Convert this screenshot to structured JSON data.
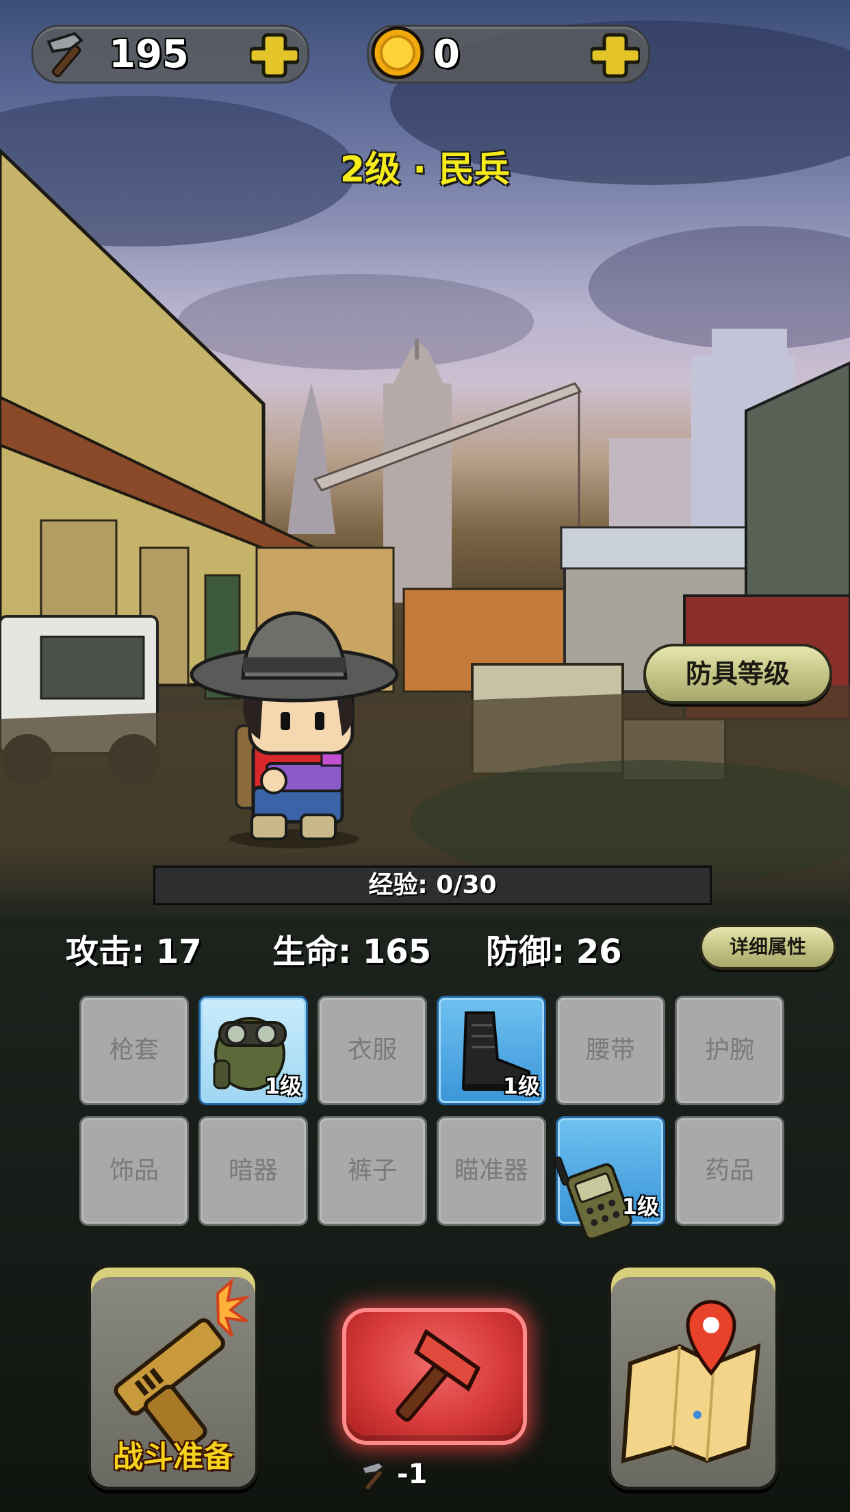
{
  "resources": {
    "hammers": {
      "icon": "hammer-icon",
      "value": "195"
    },
    "coins": {
      "icon": "gold-coin-icon",
      "value": "0"
    }
  },
  "rank_title": "2级 · 民兵",
  "armor_level_button": "防具等级",
  "experience": {
    "label": "经验: 0/30",
    "current": 0,
    "max": 30
  },
  "stats": {
    "attack": "攻击: 17",
    "health": "生命: 165",
    "defense": "防御: 26"
  },
  "details_button": "详细属性",
  "equipment_slots": [
    {
      "label": "枪套",
      "owned": false
    },
    {
      "label": "",
      "owned": true,
      "icon": "aviator-helmet-icon",
      "level": "1级"
    },
    {
      "label": "衣服",
      "owned": false
    },
    {
      "label": "",
      "owned": true,
      "icon": "combat-boot-icon",
      "level": "1级"
    },
    {
      "label": "腰带",
      "owned": false
    },
    {
      "label": "护腕",
      "owned": false
    },
    {
      "label": "饰品",
      "owned": false
    },
    {
      "label": "暗器",
      "owned": false
    },
    {
      "label": "裤子",
      "owned": false
    },
    {
      "label": "瞄准器",
      "owned": false
    },
    {
      "label": "",
      "owned": true,
      "icon": "walkie-talkie-icon",
      "level": "1级"
    },
    {
      "label": "药品",
      "owned": false
    }
  ],
  "actions": {
    "battle_prep": {
      "label": "战斗准备",
      "icon": "pistol-icon"
    },
    "craft": {
      "icon": "hammer-icon",
      "cost": "-1"
    },
    "map": {
      "icon": "map-pin-icon"
    }
  },
  "colors": {
    "rank_yellow": "#f6ec1c",
    "owned_slot_blue": "#3a95d8",
    "craft_red": "#d83a3a",
    "battle_caption": "#f5d21b"
  }
}
